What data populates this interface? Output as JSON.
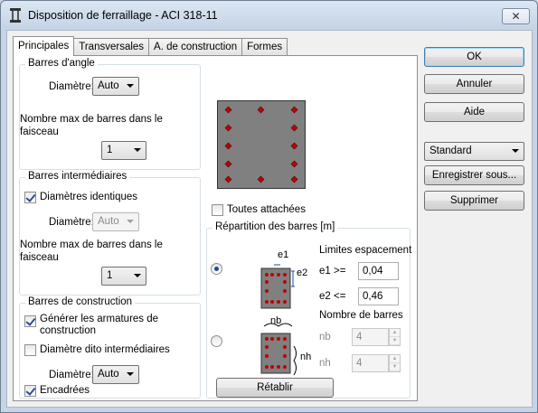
{
  "window": {
    "title": "Disposition de ferraillage - ACI 318-11",
    "close_label": "✕"
  },
  "tabs": [
    {
      "label": "Principales",
      "active": true
    },
    {
      "label": "Transversales"
    },
    {
      "label": "A. de construction"
    },
    {
      "label": "Formes"
    }
  ],
  "corner_bars": {
    "group_label": "Barres d'angle",
    "diameter_label": "Diamètre:",
    "diameter_value": "Auto",
    "max_bars_label": "Nombre max de barres dans le faisceau",
    "max_bars_value": "1"
  },
  "intermediate_bars": {
    "group_label": "Barres intermédiaires",
    "identical_label": "Diamètres identiques",
    "identical_checked": true,
    "diameter_label": "Diamètre:",
    "diameter_value": "Auto",
    "max_bars_label": "Nombre max de barres dans le faisceau",
    "max_bars_value": "1"
  },
  "construction_bars": {
    "group_label": "Barres de construction",
    "generate_label": "Générer les armatures de construction",
    "generate_checked": true,
    "ditto_label": "Diamètre dito intermédiaires",
    "ditto_checked": false,
    "diameter_label": "Diamètre:",
    "diameter_value": "Auto",
    "framed_label": "Encadrées",
    "framed_checked": true
  },
  "all_tied": {
    "label": "Toutes attachées",
    "checked": false
  },
  "distribution": {
    "group_label": "Répartition des barres [m]",
    "spacing_label": "Limites espacement",
    "e1_label": "e1 >=",
    "e1_value": "0,04",
    "e2_label": "e2 <=",
    "e2_value": "0,46",
    "dim_e1": "e1",
    "dim_e2": "e2",
    "count_label": "Nombre de barres",
    "nb_label": "nb",
    "nb_value": "4",
    "nh_label": "nh",
    "nh_value": "4",
    "dim_nb": "nb",
    "dim_nh": "nh",
    "selected_option": "spacing"
  },
  "reset_button": "Rétablir",
  "side": {
    "ok": "OK",
    "cancel": "Annuler",
    "help": "Aide",
    "preset_value": "Standard",
    "save_as": "Enregistrer sous...",
    "delete": "Supprimer"
  },
  "colors": {
    "section_fill": "#808080",
    "bar_color": "#c00000",
    "accent": "#3c7fb1"
  }
}
